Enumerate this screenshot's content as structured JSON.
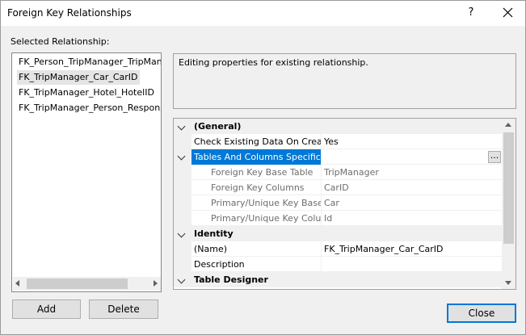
{
  "window": {
    "title": "Foreign Key Relationships",
    "help_label": "?",
    "close_icon": "close-icon"
  },
  "relationships": {
    "label": "Selected Relationship:",
    "items": [
      {
        "label": "FK_Person_TripManager_TripMan"
      },
      {
        "label": "FK_TripManager_Car_CarID",
        "selected": true
      },
      {
        "label": "FK_TripManager_Hotel_HotelID"
      },
      {
        "label": "FK_TripManager_Person_Respons"
      }
    ],
    "add_label": "Add",
    "delete_label": "Delete"
  },
  "description": {
    "text": "Editing properties for existing relationship."
  },
  "properties": {
    "general": {
      "label": "(General)"
    },
    "check_existing": {
      "name": "Check Existing Data On Creati",
      "value": "Yes"
    },
    "tables_columns": {
      "name": "Tables And Columns Specificat",
      "value": "",
      "button": "..."
    },
    "fk_base_table": {
      "name": "Foreign Key Base Table",
      "value": "TripManager"
    },
    "fk_columns": {
      "name": "Foreign Key Columns",
      "value": "CarID"
    },
    "pk_base": {
      "name": "Primary/Unique Key Base",
      "value": "Car"
    },
    "pk_columns": {
      "name": "Primary/Unique Key Colu",
      "value": "Id"
    },
    "identity": {
      "label": "Identity"
    },
    "name_prop": {
      "name": "(Name)",
      "value": "FK_TripManager_Car_CarID"
    },
    "description_prop": {
      "name": "Description",
      "value": ""
    },
    "table_designer": {
      "label": "Table Designer"
    }
  },
  "footer": {
    "close_label": "Close"
  },
  "colors": {
    "accent": "#0078d7",
    "selection_gray": "#e5e5e5"
  }
}
